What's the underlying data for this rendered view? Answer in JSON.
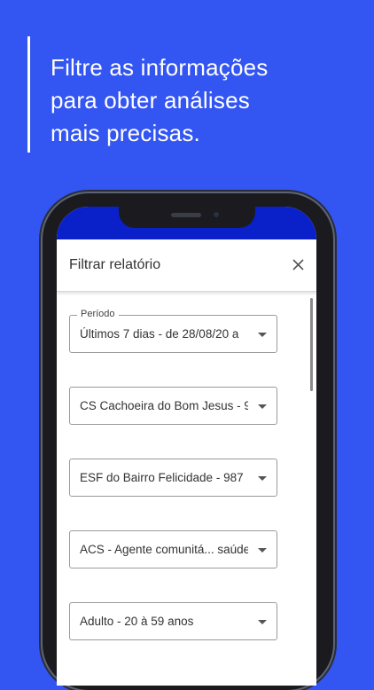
{
  "headline": {
    "line1": "Filtre as informações",
    "line2": "para obter análises",
    "line3": "mais precisas."
  },
  "dialog": {
    "title": "Filtrar relatório",
    "close_icon": "close-icon"
  },
  "filters": [
    {
      "label": "Período",
      "value": "Últimos 7 dias - de 28/08/20 a"
    },
    {
      "label": "",
      "value": "CS Cachoeira do Bom Jesus - 9"
    },
    {
      "label": "",
      "value": "ESF do Bairro Felicidade - 987"
    },
    {
      "label": "",
      "value": "ACS - Agente comunitá... saúde"
    },
    {
      "label": "",
      "value": "Adulto - 20 à 59 anos"
    }
  ],
  "colors": {
    "background": "#3355f2",
    "status_bar": "#0a21c9"
  }
}
